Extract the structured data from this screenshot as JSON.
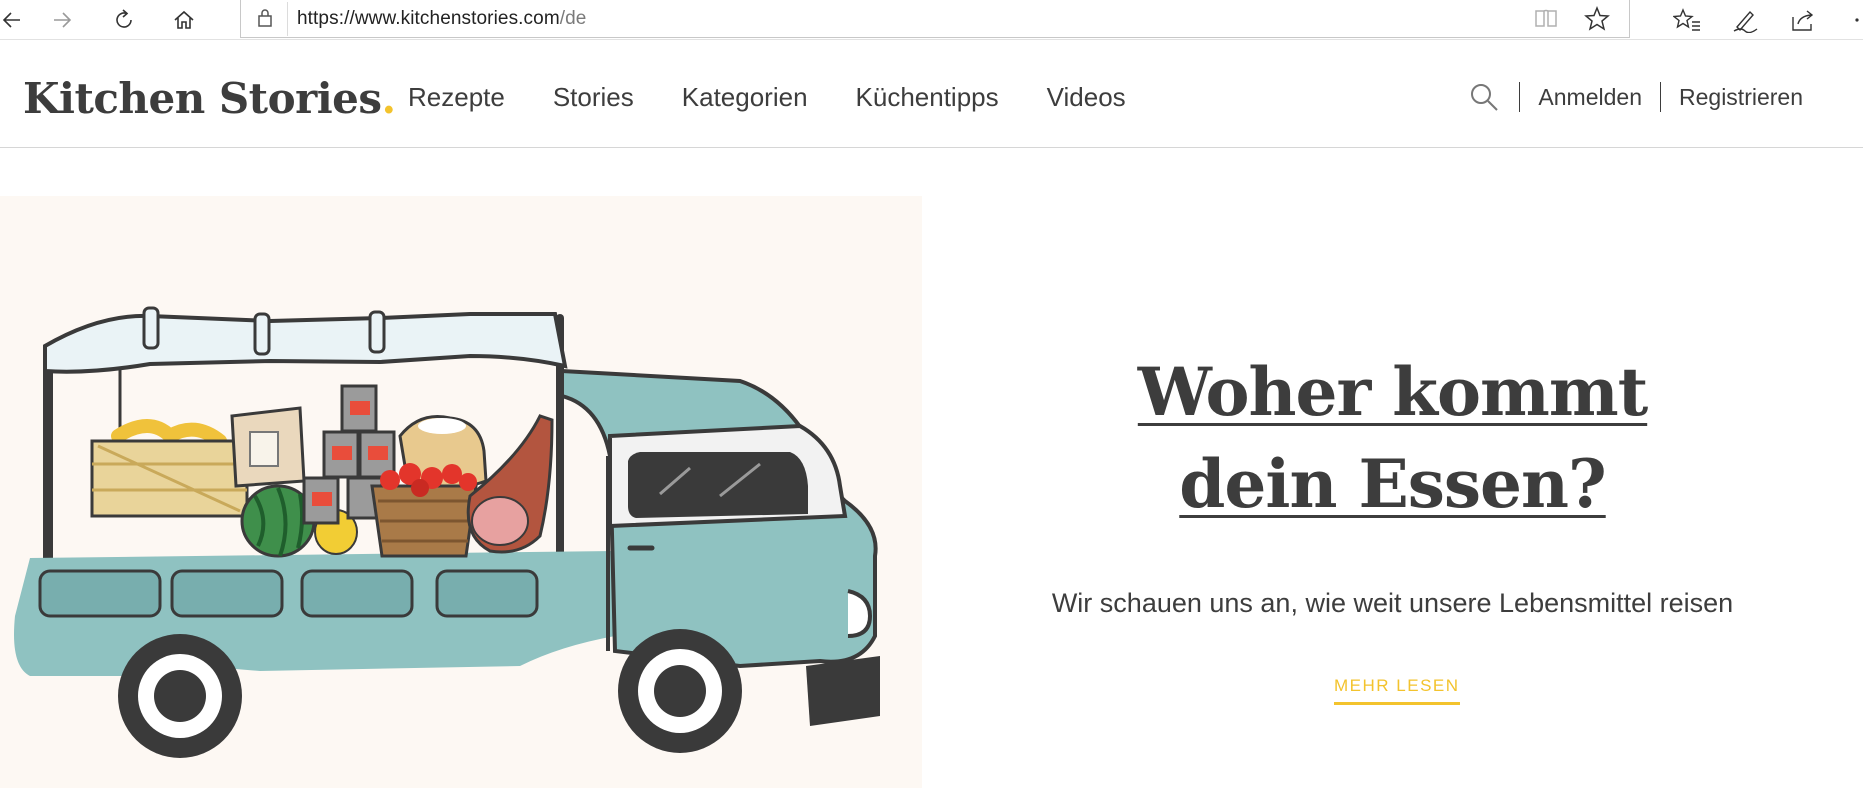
{
  "browser": {
    "url_host": "https://www.kitchenstories.com",
    "url_path": "/de",
    "icons": [
      "back-icon",
      "forward-icon",
      "refresh-icon",
      "home-icon",
      "lock-icon",
      "reading-view-icon",
      "favorite-star-icon",
      "favorites-list-icon",
      "pen-icon",
      "share-icon",
      "more-icon"
    ]
  },
  "header": {
    "logo_text": "Kitchen Stories",
    "logo_dot": ".",
    "nav": [
      "Rezepte",
      "Stories",
      "Kategorien",
      "Küchentipps",
      "Videos"
    ],
    "login": "Anmelden",
    "register": "Registrieren"
  },
  "hero": {
    "title": "Woher kommt dein Essen?",
    "subtitle": "Wir schauen uns an, wie weit unsere Lebensmittel reisen",
    "cta": "MEHR LESEN"
  },
  "colors": {
    "accent": "#f3c32d",
    "text": "#3d3d3d",
    "truck": "#8fc2c1",
    "hero_bg": "#fdf8f3"
  }
}
